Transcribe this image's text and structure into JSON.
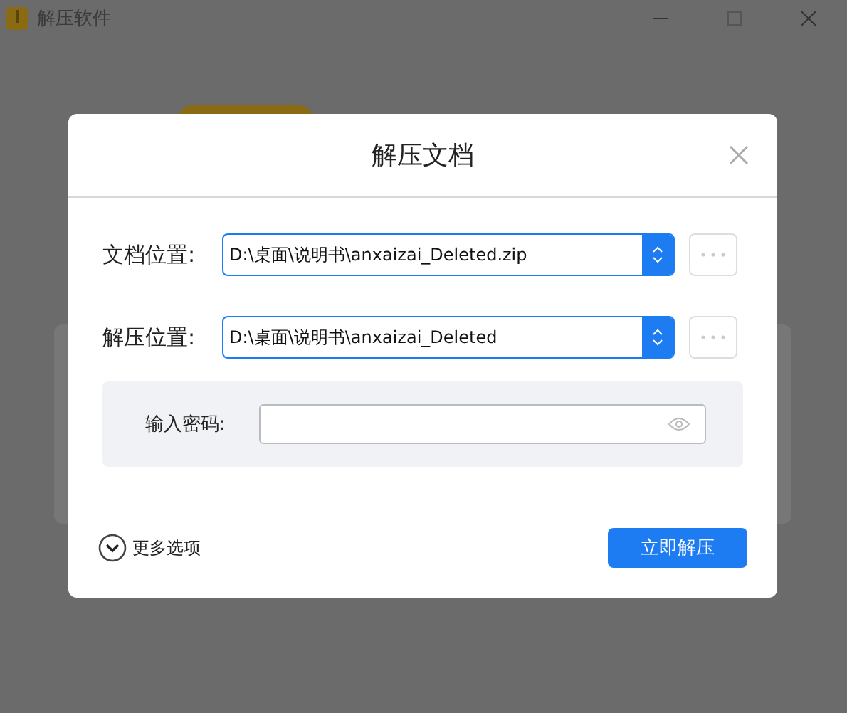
{
  "window": {
    "title": "解压软件"
  },
  "dialog": {
    "title": "解压文档",
    "fields": [
      {
        "label": "文档位置:",
        "value": "D:\\桌面\\说明书\\anxaizai_Deleted.zip"
      },
      {
        "label": "解压位置:",
        "value": "D:\\桌面\\说明书\\anxaizai_Deleted"
      }
    ],
    "password": {
      "label": "输入密码:"
    },
    "more_options": {
      "label": "更多选项",
      "expanded": false
    },
    "primary_button": "立即解压"
  }
}
